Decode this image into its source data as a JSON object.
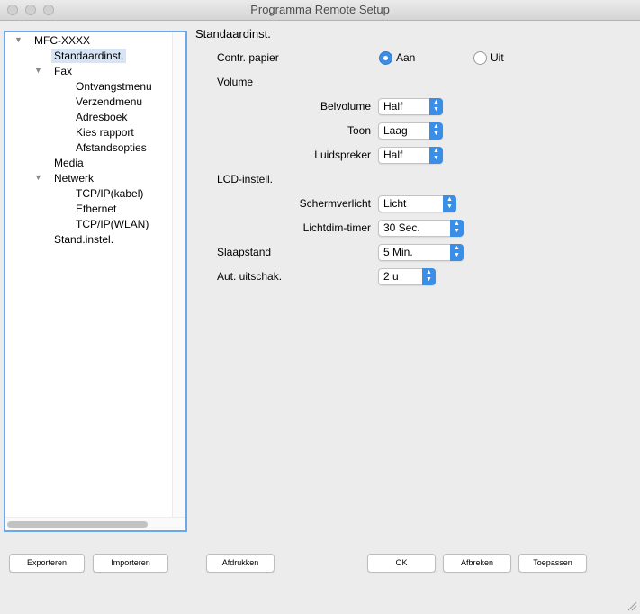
{
  "window": {
    "title": "Programma Remote Setup"
  },
  "tree": {
    "root": "MFC-XXXX",
    "standaardinst": "Standaardinst.",
    "fax": "Fax",
    "ontvangstmenu": "Ontvangstmenu",
    "verzendmenu": "Verzendmenu",
    "adresboek": "Adresboek",
    "kies_rapport": "Kies rapport",
    "afstandsopties": "Afstandsopties",
    "media": "Media",
    "netwerk": "Netwerk",
    "tcpip_kabel": "TCP/IP(kabel)",
    "ethernet": "Ethernet",
    "tcpip_wlan": "TCP/IP(WLAN)",
    "stand_instel": "Stand.instel."
  },
  "panel": {
    "title": "Standaardinst.",
    "contr_papier": {
      "label": "Contr. papier",
      "on_label": "Aan",
      "off_label": "Uit",
      "selected": "Aan"
    },
    "volume": {
      "heading": "Volume",
      "belvolume": {
        "label": "Belvolume",
        "value": "Half"
      },
      "toon": {
        "label": "Toon",
        "value": "Laag"
      },
      "luidspreker": {
        "label": "Luidspreker",
        "value": "Half"
      }
    },
    "lcd": {
      "heading": "LCD-instell.",
      "schermverlicht": {
        "label": "Schermverlicht",
        "value": "Licht"
      },
      "lichtdim_timer": {
        "label": "Lichtdim-timer",
        "value": "30 Sec."
      }
    },
    "slaapstand": {
      "label": "Slaapstand",
      "value": "5 Min."
    },
    "aut_uitschak": {
      "label": "Aut. uitschak.",
      "value": "2 u"
    }
  },
  "buttons": {
    "exporteren": "Exporteren",
    "importeren": "Importeren",
    "afdrukken": "Afdrukken",
    "ok": "OK",
    "afbreken": "Afbreken",
    "toepassen": "Toepassen"
  },
  "icons": {
    "expand": "disclosure-triangle-icon",
    "stepper": "up-down-stepper-icon",
    "resize": "resize-grip-icon"
  },
  "colors": {
    "accent": "#3b8ee6",
    "focus_ring": "#6aa9e9",
    "selection": "#d6e4f5"
  }
}
